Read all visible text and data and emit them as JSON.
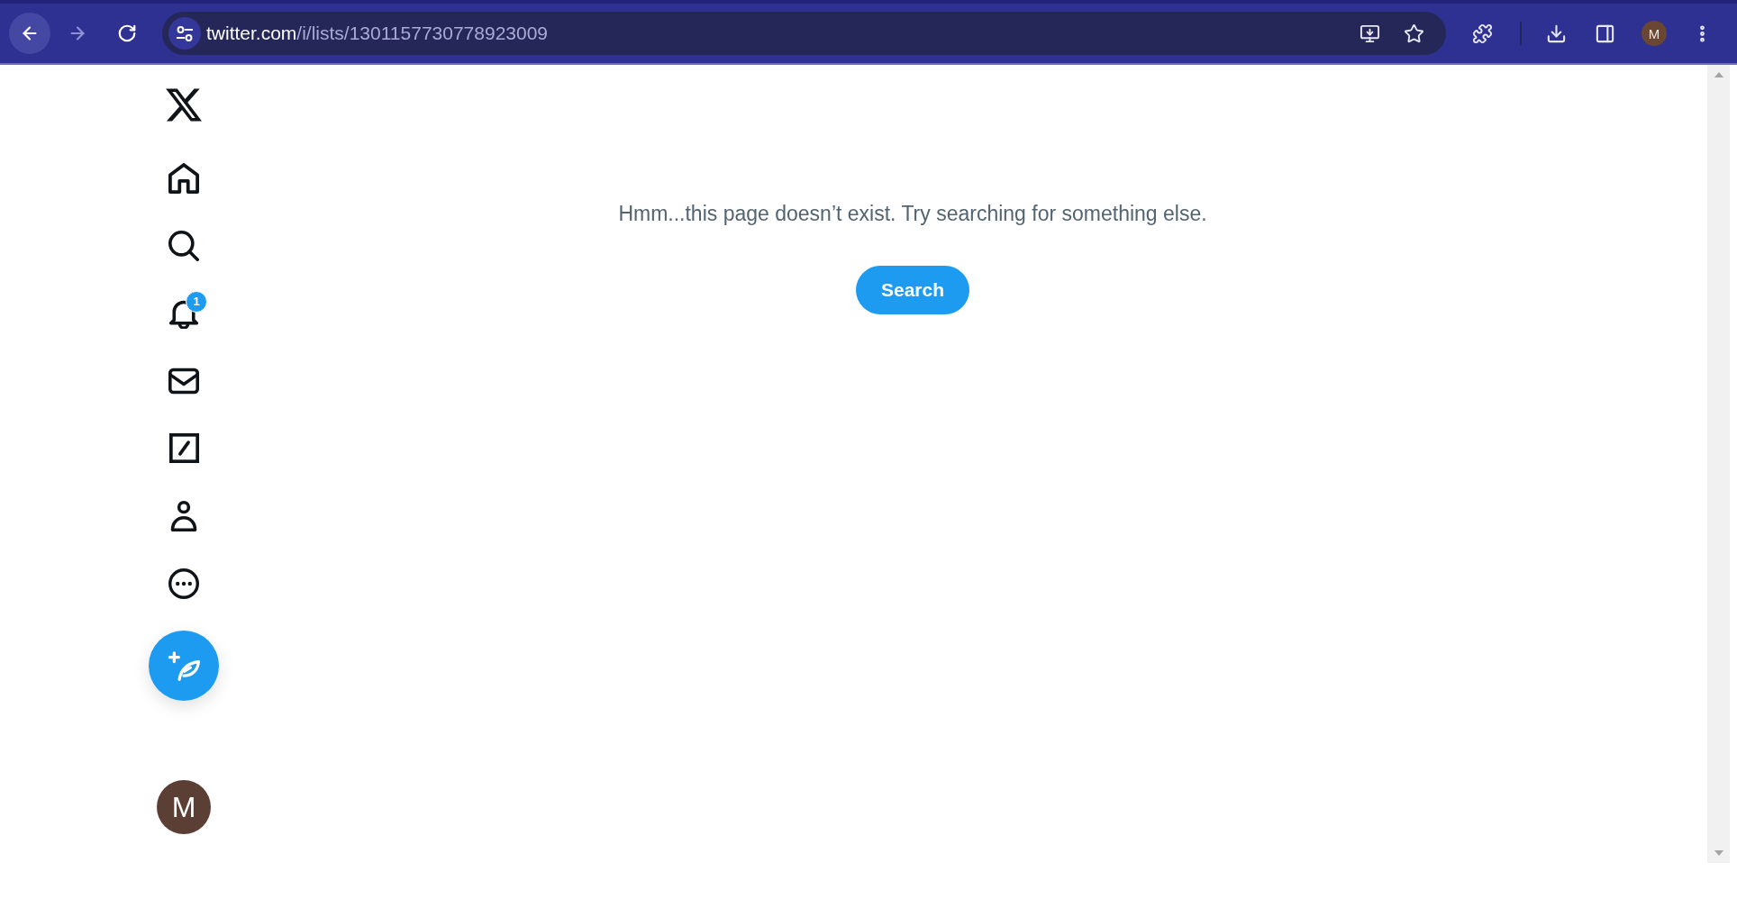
{
  "browser": {
    "nav_buttons": [
      {
        "kind": "back",
        "highlighted": true,
        "disabled": false
      },
      {
        "kind": "forward",
        "highlighted": false,
        "disabled": true
      },
      {
        "kind": "reload",
        "highlighted": false,
        "disabled": false
      }
    ],
    "address_bar": {
      "host": "twitter.com",
      "path": "/i/lists/1301157730778923009",
      "actions": [
        {
          "kind": "install"
        },
        {
          "kind": "bookmark"
        }
      ]
    },
    "toolbar": [
      {
        "kind": "extensions"
      },
      {
        "kind": "separator"
      },
      {
        "kind": "downloads"
      },
      {
        "kind": "side_panel"
      },
      {
        "kind": "profile",
        "initial": "M"
      },
      {
        "kind": "menu"
      }
    ]
  },
  "sidebar": {
    "items": [
      {
        "kind": "logo"
      },
      {
        "kind": "home"
      },
      {
        "kind": "explore"
      },
      {
        "kind": "notifications",
        "badge": "1"
      },
      {
        "kind": "messages"
      },
      {
        "kind": "grok"
      },
      {
        "kind": "profile"
      },
      {
        "kind": "more"
      },
      {
        "kind": "post"
      }
    ],
    "account": {
      "initial": "M"
    }
  },
  "main": {
    "message": "Hmm...this page doesn’t exist. Try searching for something else.",
    "button": "Search"
  }
}
